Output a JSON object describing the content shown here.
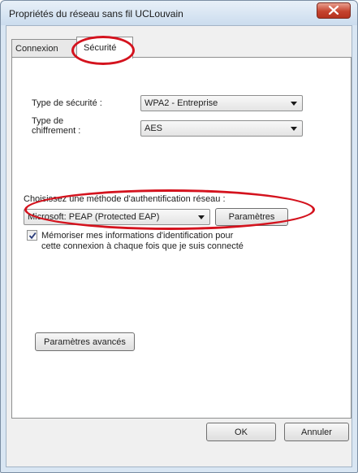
{
  "window": {
    "title": "Propriétés du réseau sans fil UCLouvain"
  },
  "tabs": [
    {
      "label": "Connexion",
      "active": false
    },
    {
      "label": "Sécurité",
      "active": true
    }
  ],
  "security": {
    "type_label": "Type de sécurité :",
    "type_value": "WPA2 - Entreprise",
    "encryption_label_line1": "Type de",
    "encryption_label_line2": "chiffrement :",
    "encryption_value": "AES",
    "auth_method_label": "Choisissez une méthode d'authentification réseau :",
    "auth_method_value": "Microsoft: PEAP (Protected EAP)",
    "params_button": "Paramètres",
    "remember_checked": true,
    "remember_line1": "Mémoriser mes informations d'identification pour",
    "remember_line2": "cette connexion à chaque fois que je suis connecté",
    "advanced_button": "Paramètres avancés"
  },
  "footer": {
    "ok_button": "OK",
    "cancel_button": "Annuler"
  },
  "colors": {
    "annotation_ring": "#d4131e",
    "close_button": "#c5442f"
  },
  "icons": {
    "close": "close-x-icon",
    "checkmark": "checkmark-icon",
    "dropdown": "dropdown-arrow-icon"
  }
}
